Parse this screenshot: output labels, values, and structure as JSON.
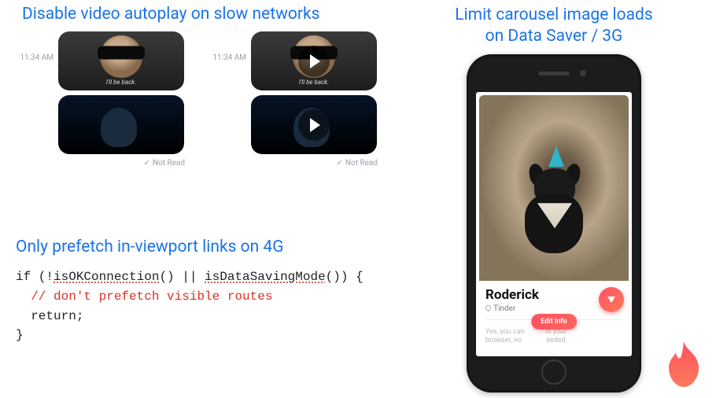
{
  "sec1": {
    "heading": "Disable video autoplay on slow networks",
    "timestamp": "11:34 AM",
    "caption": "I'll be back.",
    "not_read": "Not Read"
  },
  "sec2": {
    "heading": "Only prefetch in-viewport links on 4G",
    "code_line1_a": "if (!",
    "code_line1_b": "isOKConnection",
    "code_line1_c": "() || ",
    "code_line1_d": "isDataSavingMode",
    "code_line1_e": "()) {",
    "code_line2": "  // don't prefetch visible routes",
    "code_line3": "  return;",
    "code_line4": "}"
  },
  "sec3": {
    "heading_l1": "Limit carousel image loads",
    "heading_l2": "on Data Saver / 3G",
    "card_name": "Roderick",
    "card_sub": "Tinder",
    "prompt_a": "Yes, you can",
    "prompt_b": "in your",
    "prompt_c": "browser, no",
    "prompt_d": "eeded.",
    "edit_label": "Edit Info"
  }
}
